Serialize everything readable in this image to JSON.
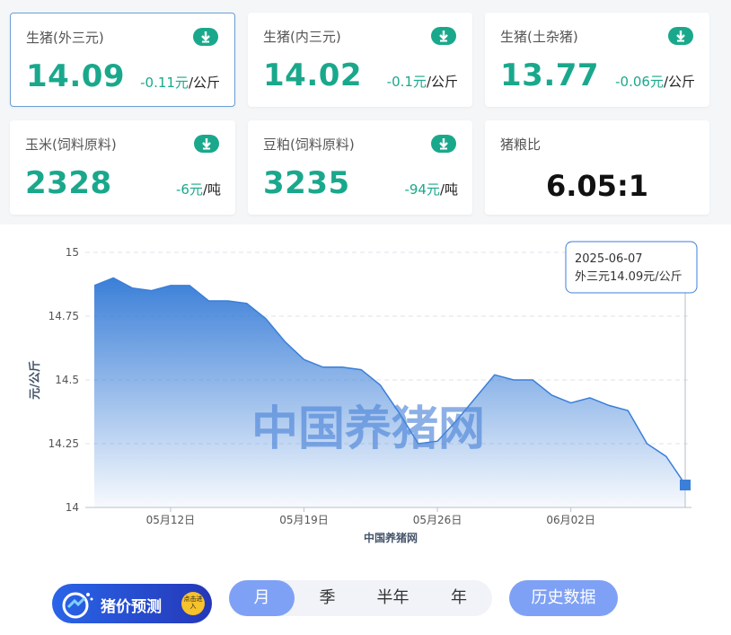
{
  "cards": [
    {
      "name": "生猪(外三元)",
      "price": "14.09",
      "change": "-0.11元",
      "unit": "/公斤"
    },
    {
      "name": "生猪(内三元)",
      "price": "14.02",
      "change": "-0.1元",
      "unit": "/公斤"
    },
    {
      "name": "生猪(土杂猪)",
      "price": "13.77",
      "change": "-0.06元",
      "unit": "/公斤"
    },
    {
      "name": "玉米(饲料原料)",
      "price": "2328",
      "change": "-6元",
      "unit": "/吨"
    },
    {
      "name": "豆粕(饲料原料)",
      "price": "3235",
      "change": "-94元",
      "unit": "/吨"
    },
    {
      "name": "猪粮比",
      "ratio": "6.05:1"
    }
  ],
  "chart_data": {
    "type": "area",
    "ylabel": "元/公斤",
    "xlabel": "中国养猪网",
    "watermark": "中国养猪网",
    "ylim": [
      14,
      15
    ],
    "yticks": [
      "15",
      "14.75",
      "14.5",
      "14.25",
      "14"
    ],
    "x": [
      "2025-05-08",
      "2025-05-09",
      "2025-05-10",
      "2025-05-11",
      "2025-05-12",
      "2025-05-13",
      "2025-05-14",
      "2025-05-15",
      "2025-05-16",
      "2025-05-17",
      "2025-05-18",
      "2025-05-19",
      "2025-05-20",
      "2025-05-21",
      "2025-05-22",
      "2025-05-23",
      "2025-05-24",
      "2025-05-25",
      "2025-05-26",
      "2025-05-27",
      "2025-05-28",
      "2025-05-29",
      "2025-05-30",
      "2025-05-31",
      "2025-06-01",
      "2025-06-02",
      "2025-06-03",
      "2025-06-04",
      "2025-06-05",
      "2025-06-06",
      "2025-06-07"
    ],
    "values": [
      14.87,
      14.9,
      14.86,
      14.85,
      14.87,
      14.87,
      14.81,
      14.81,
      14.8,
      14.74,
      14.65,
      14.58,
      14.55,
      14.55,
      14.54,
      14.48,
      14.37,
      14.25,
      14.26,
      14.34,
      14.43,
      14.52,
      14.5,
      14.5,
      14.44,
      14.41,
      14.43,
      14.4,
      14.38,
      14.25,
      14.2,
      14.09
    ],
    "xtick_labels": [
      {
        "label": "05月12日",
        "index": 4
      },
      {
        "label": "05月19日",
        "index": 11
      },
      {
        "label": "05月26日",
        "index": 18
      },
      {
        "label": "06月02日",
        "index": 25
      }
    ],
    "tooltip": {
      "date": "2025-06-07",
      "text": "外三元14.09元/公斤"
    },
    "grid": "horizontal-dashed",
    "colors": {
      "line": "#3b7fd8",
      "fill_top": "#3b7fd8",
      "fill_bottom": "#ffffff",
      "accent": "#1aa88c"
    }
  },
  "promo": {
    "text": "猪价预测",
    "badge": "点击进入"
  },
  "periods": [
    {
      "label": "月",
      "selected": true
    },
    {
      "label": "季"
    },
    {
      "label": "半年"
    },
    {
      "label": "年"
    }
  ],
  "history_button": "历史数据"
}
